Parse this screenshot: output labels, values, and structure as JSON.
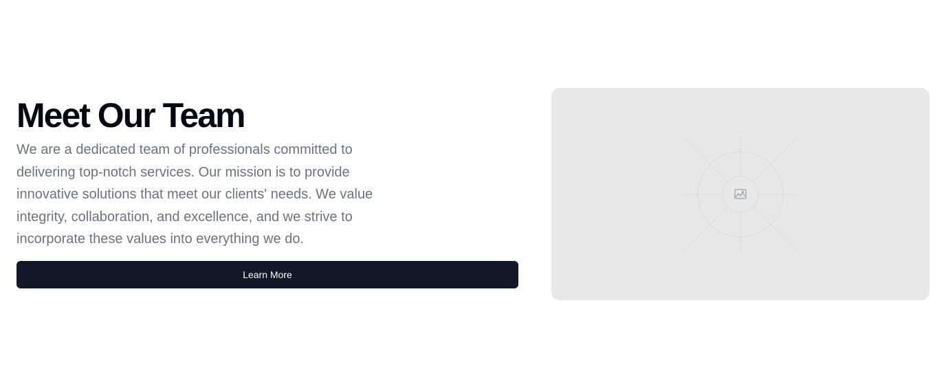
{
  "hero": {
    "title": "Meet Our Team",
    "description": "We are a dedicated team of professionals committed to delivering top-notch services. Our mission is to provide innovative solutions that meet our clients' needs. We value integrity, collaboration, and excellence, and we strive to incorporate these values into everything we do.",
    "button_label": "Learn More",
    "image_icon": "image-icon"
  },
  "colors": {
    "title": "#030712",
    "text_muted": "#6b7280",
    "button_bg": "#111827",
    "button_text": "#f9fafb",
    "placeholder_bg": "#e8e8e8"
  }
}
